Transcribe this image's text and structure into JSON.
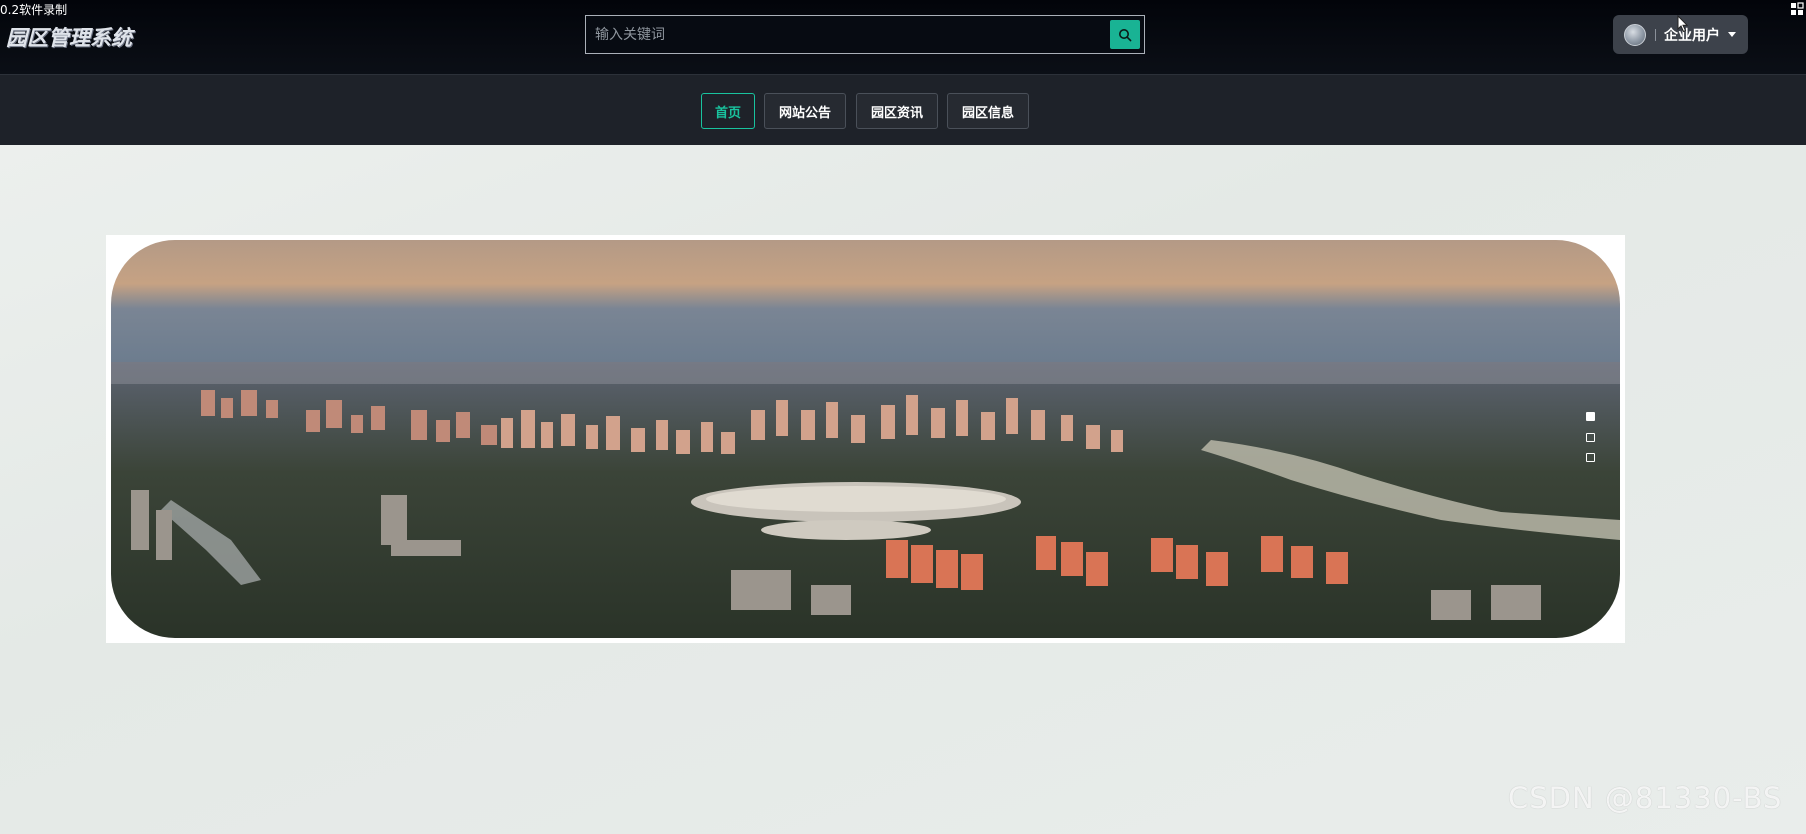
{
  "recorder": {
    "label": "0.2软件录制"
  },
  "header": {
    "logo": "园区管理系统",
    "search": {
      "placeholder": "输入关键词",
      "value": "",
      "icon": "search-icon"
    },
    "user": {
      "name": "企业用户",
      "avatar_icon": "avatar",
      "caret_icon": "caret-down-icon"
    }
  },
  "nav": {
    "items": [
      {
        "label": "首页",
        "active": true
      },
      {
        "label": "网站公告",
        "active": false
      },
      {
        "label": "园区资讯",
        "active": false
      },
      {
        "label": "园区信息",
        "active": false
      }
    ]
  },
  "carousel": {
    "slide_count": 3,
    "active_index": 0
  },
  "watermark": "CSDN @81330-BS",
  "colors": {
    "accent": "#19b394",
    "header_bg": "#070b12",
    "nav_bg": "#1e2229"
  }
}
